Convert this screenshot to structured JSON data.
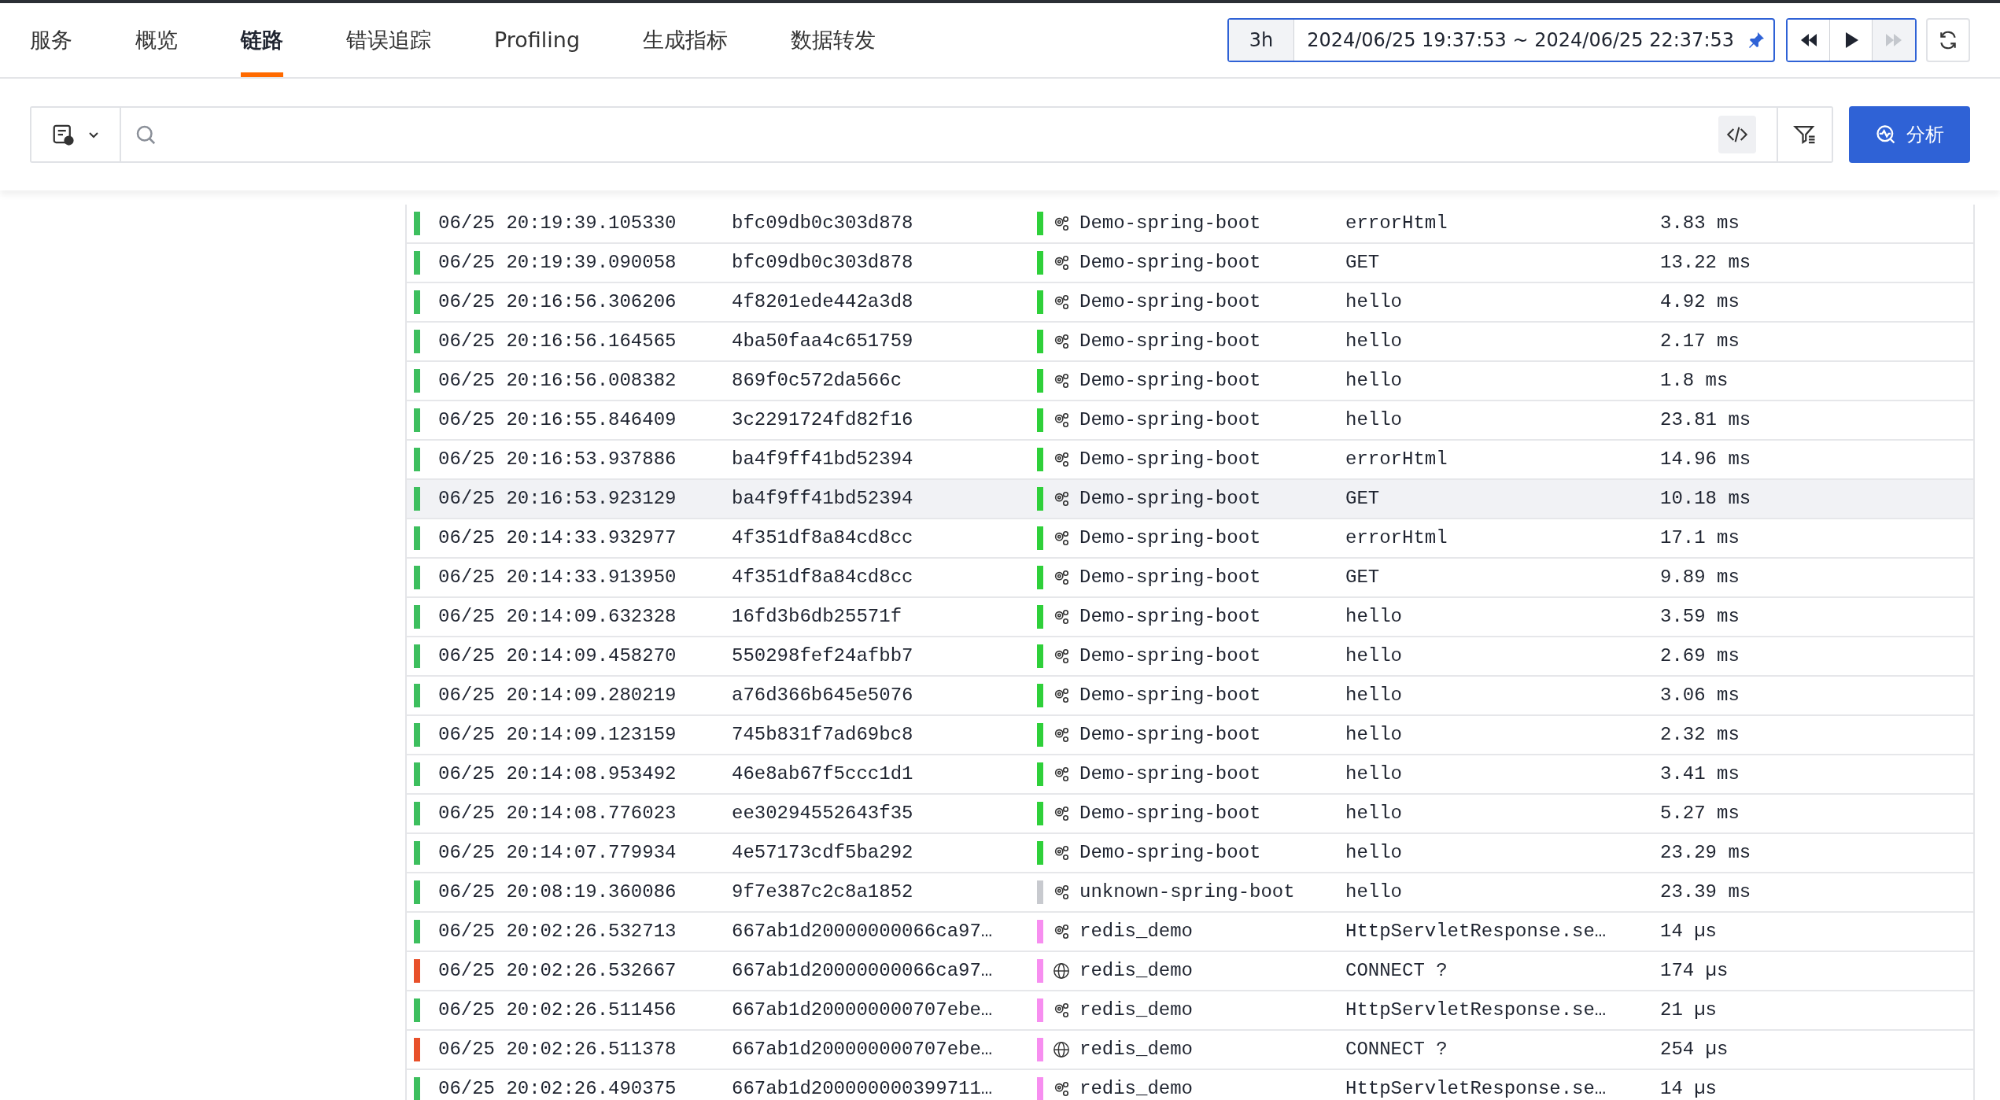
{
  "tabs": [
    {
      "label": "服务",
      "selected": false
    },
    {
      "label": "概览",
      "selected": false
    },
    {
      "label": "链路",
      "selected": true
    },
    {
      "label": "错误追踪",
      "selected": false
    },
    {
      "label": "Profiling",
      "selected": false
    },
    {
      "label": "生成指标",
      "selected": false
    },
    {
      "label": "数据转发",
      "selected": false
    }
  ],
  "time_range": {
    "preset": "3h",
    "range": "2024/06/25 19:37:53 ~ 2024/06/25 22:37:53",
    "pinned": true
  },
  "playback": [
    {
      "kind": "back",
      "disabled": false
    },
    {
      "kind": "play",
      "disabled": false
    },
    {
      "kind": "forward",
      "disabled": true
    }
  ],
  "search": {
    "analyze_button": "分析"
  },
  "rows": [
    {
      "time": "06/25 20:19:39.105330",
      "trace_id": "bfc09db0c303d878",
      "status": {
        "color": "#3dbf5e"
      },
      "kind": "service",
      "service": {
        "name": "Demo-spring-boot",
        "color": "#2fd03a"
      },
      "endpoint": "errorHtml",
      "duration": "3.83 ms",
      "selected": false
    },
    {
      "time": "06/25 20:19:39.090058",
      "trace_id": "bfc09db0c303d878",
      "status": {
        "color": "#3dbf5e"
      },
      "kind": "service",
      "service": {
        "name": "Demo-spring-boot",
        "color": "#2fd03a"
      },
      "endpoint": "GET",
      "duration": "13.22 ms",
      "selected": false
    },
    {
      "time": "06/25 20:16:56.306206",
      "trace_id": "4f8201ede442a3d8",
      "status": {
        "color": "#3dbf5e"
      },
      "kind": "service",
      "service": {
        "name": "Demo-spring-boot",
        "color": "#2fd03a"
      },
      "endpoint": "hello",
      "duration": "4.92 ms",
      "selected": false
    },
    {
      "time": "06/25 20:16:56.164565",
      "trace_id": "4ba50faa4c651759",
      "status": {
        "color": "#3dbf5e"
      },
      "kind": "service",
      "service": {
        "name": "Demo-spring-boot",
        "color": "#2fd03a"
      },
      "endpoint": "hello",
      "duration": "2.17 ms",
      "selected": false
    },
    {
      "time": "06/25 20:16:56.008382",
      "trace_id": "869f0c572da566c",
      "status": {
        "color": "#3dbf5e"
      },
      "kind": "service",
      "service": {
        "name": "Demo-spring-boot",
        "color": "#2fd03a"
      },
      "endpoint": "hello",
      "duration": "1.8 ms",
      "selected": false
    },
    {
      "time": "06/25 20:16:55.846409",
      "trace_id": "3c2291724fd82f16",
      "status": {
        "color": "#3dbf5e"
      },
      "kind": "service",
      "service": {
        "name": "Demo-spring-boot",
        "color": "#2fd03a"
      },
      "endpoint": "hello",
      "duration": "23.81 ms",
      "selected": false
    },
    {
      "time": "06/25 20:16:53.937886",
      "trace_id": "ba4f9ff41bd52394",
      "status": {
        "color": "#3dbf5e"
      },
      "kind": "service",
      "service": {
        "name": "Demo-spring-boot",
        "color": "#2fd03a"
      },
      "endpoint": "errorHtml",
      "duration": "14.96 ms",
      "selected": false
    },
    {
      "time": "06/25 20:16:53.923129",
      "trace_id": "ba4f9ff41bd52394",
      "status": {
        "color": "#3dbf5e"
      },
      "kind": "service",
      "service": {
        "name": "Demo-spring-boot",
        "color": "#2fd03a"
      },
      "endpoint": "GET",
      "duration": "10.18 ms",
      "selected": true
    },
    {
      "time": "06/25 20:14:33.932977",
      "trace_id": "4f351df8a84cd8cc",
      "status": {
        "color": "#3dbf5e"
      },
      "kind": "service",
      "service": {
        "name": "Demo-spring-boot",
        "color": "#2fd03a"
      },
      "endpoint": "errorHtml",
      "duration": "17.1 ms",
      "selected": false
    },
    {
      "time": "06/25 20:14:33.913950",
      "trace_id": "4f351df8a84cd8cc",
      "status": {
        "color": "#3dbf5e"
      },
      "kind": "service",
      "service": {
        "name": "Demo-spring-boot",
        "color": "#2fd03a"
      },
      "endpoint": "GET",
      "duration": "9.89 ms",
      "selected": false
    },
    {
      "time": "06/25 20:14:09.632328",
      "trace_id": "16fd3b6db25571f",
      "status": {
        "color": "#3dbf5e"
      },
      "kind": "service",
      "service": {
        "name": "Demo-spring-boot",
        "color": "#2fd03a"
      },
      "endpoint": "hello",
      "duration": "3.59 ms",
      "selected": false
    },
    {
      "time": "06/25 20:14:09.458270",
      "trace_id": "550298fef24afbb7",
      "status": {
        "color": "#3dbf5e"
      },
      "kind": "service",
      "service": {
        "name": "Demo-spring-boot",
        "color": "#2fd03a"
      },
      "endpoint": "hello",
      "duration": "2.69 ms",
      "selected": false
    },
    {
      "time": "06/25 20:14:09.280219",
      "trace_id": "a76d366b645e5076",
      "status": {
        "color": "#3dbf5e"
      },
      "kind": "service",
      "service": {
        "name": "Demo-spring-boot",
        "color": "#2fd03a"
      },
      "endpoint": "hello",
      "duration": "3.06 ms",
      "selected": false
    },
    {
      "time": "06/25 20:14:09.123159",
      "trace_id": "745b831f7ad69bc8",
      "status": {
        "color": "#3dbf5e"
      },
      "kind": "service",
      "service": {
        "name": "Demo-spring-boot",
        "color": "#2fd03a"
      },
      "endpoint": "hello",
      "duration": "2.32 ms",
      "selected": false
    },
    {
      "time": "06/25 20:14:08.953492",
      "trace_id": "46e8ab67f5ccc1d1",
      "status": {
        "color": "#3dbf5e"
      },
      "kind": "service",
      "service": {
        "name": "Demo-spring-boot",
        "color": "#2fd03a"
      },
      "endpoint": "hello",
      "duration": "3.41 ms",
      "selected": false
    },
    {
      "time": "06/25 20:14:08.776023",
      "trace_id": "ee30294552643f35",
      "status": {
        "color": "#3dbf5e"
      },
      "kind": "service",
      "service": {
        "name": "Demo-spring-boot",
        "color": "#2fd03a"
      },
      "endpoint": "hello",
      "duration": "5.27 ms",
      "selected": false
    },
    {
      "time": "06/25 20:14:07.779934",
      "trace_id": "4e57173cdf5ba292",
      "status": {
        "color": "#3dbf5e"
      },
      "kind": "service",
      "service": {
        "name": "Demo-spring-boot",
        "color": "#2fd03a"
      },
      "endpoint": "hello",
      "duration": "23.29 ms",
      "selected": false
    },
    {
      "time": "06/25 20:08:19.360086",
      "trace_id": "9f7e387c2c8a1852",
      "status": {
        "color": "#3dbf5e"
      },
      "kind": "service",
      "service": {
        "name": "unknown-spring-boot",
        "color": "#c8cacf"
      },
      "endpoint": "hello",
      "duration": "23.39 ms",
      "selected": false
    },
    {
      "time": "06/25 20:02:26.532713",
      "trace_id": "667ab1d20000000066ca97…",
      "status": {
        "color": "#3dbf5e"
      },
      "kind": "service",
      "service": {
        "name": "redis_demo",
        "color": "#f78ef0"
      },
      "endpoint": "HttpServletResponse.se…",
      "duration": "14 µs",
      "selected": false
    },
    {
      "time": "06/25 20:02:26.532667",
      "trace_id": "667ab1d20000000066ca97…",
      "status": {
        "color": "#e8502a"
      },
      "kind": "network",
      "service": {
        "name": "redis_demo",
        "color": "#f78ef0"
      },
      "endpoint": "CONNECT ?",
      "duration": "174 µs",
      "selected": false
    },
    {
      "time": "06/25 20:02:26.511456",
      "trace_id": "667ab1d200000000707ebe…",
      "status": {
        "color": "#3dbf5e"
      },
      "kind": "service",
      "service": {
        "name": "redis_demo",
        "color": "#f78ef0"
      },
      "endpoint": "HttpServletResponse.se…",
      "duration": "21 µs",
      "selected": false
    },
    {
      "time": "06/25 20:02:26.511378",
      "trace_id": "667ab1d200000000707ebe…",
      "status": {
        "color": "#e8502a"
      },
      "kind": "network",
      "service": {
        "name": "redis_demo",
        "color": "#f78ef0"
      },
      "endpoint": "CONNECT ?",
      "duration": "254 µs",
      "selected": false
    },
    {
      "time": "06/25 20:02:26.490375",
      "trace_id": "667ab1d200000000399711…",
      "status": {
        "color": "#3dbf5e"
      },
      "kind": "service",
      "service": {
        "name": "redis_demo",
        "color": "#f78ef0"
      },
      "endpoint": "HttpServletResponse.se…",
      "duration": "14 µs",
      "selected": false
    }
  ]
}
